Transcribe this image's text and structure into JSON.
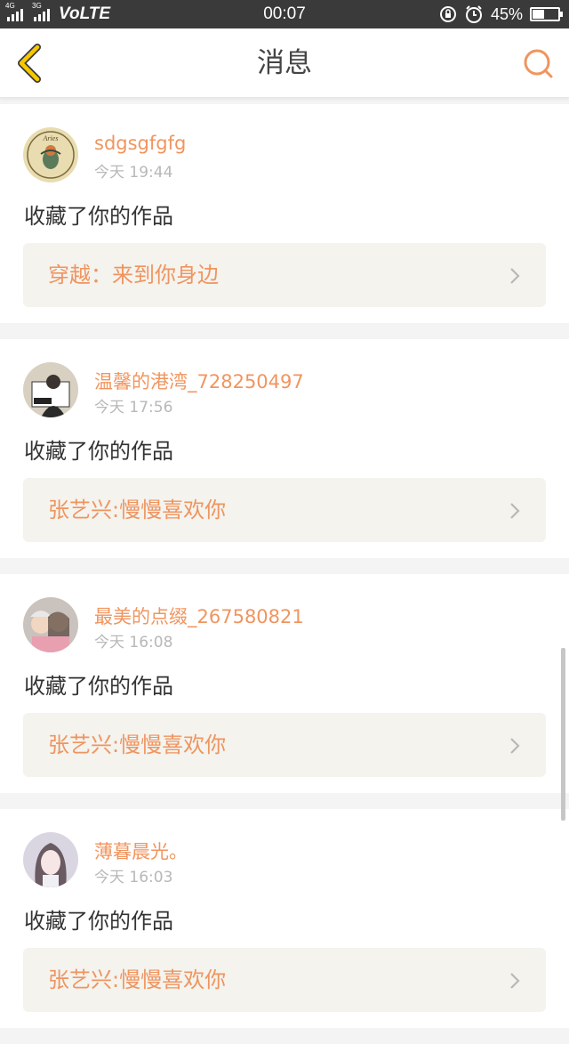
{
  "status_bar": {
    "signal1_label": "4G",
    "signal2_label": "3G",
    "volte": "VoLTE",
    "time": "00:07",
    "battery": "45%",
    "battery_level": 0.45
  },
  "header": {
    "title": "消息",
    "back_icon": "chevron-left-icon",
    "search_icon": "search-icon"
  },
  "messages": [
    {
      "username": "sdgsgfgfg",
      "time": "今天 19:44",
      "action": "收藏了你的作品",
      "work_title": "穿越：来到你身边",
      "avatar_color": "#e8dcb0"
    },
    {
      "username": "温馨的港湾_728250497",
      "time": "今天 17:56",
      "action": "收藏了你的作品",
      "work_title": "张艺兴:慢慢喜欢你",
      "avatar_color": "#d8d0c0"
    },
    {
      "username": "最美的点缀_267580821",
      "time": "今天 16:08",
      "action": "收藏了你的作品",
      "work_title": "张艺兴:慢慢喜欢你",
      "avatar_color": "#c9c2bd"
    },
    {
      "username": "薄暮晨光。",
      "time": "今天 16:03",
      "action": "收藏了你的作品",
      "work_title": "张艺兴:慢慢喜欢你",
      "avatar_color": "#d9d6e2"
    }
  ],
  "colors": {
    "accent": "#f0955f",
    "back_arrow": "#f5c800",
    "link_bg": "#f4f3ee"
  }
}
